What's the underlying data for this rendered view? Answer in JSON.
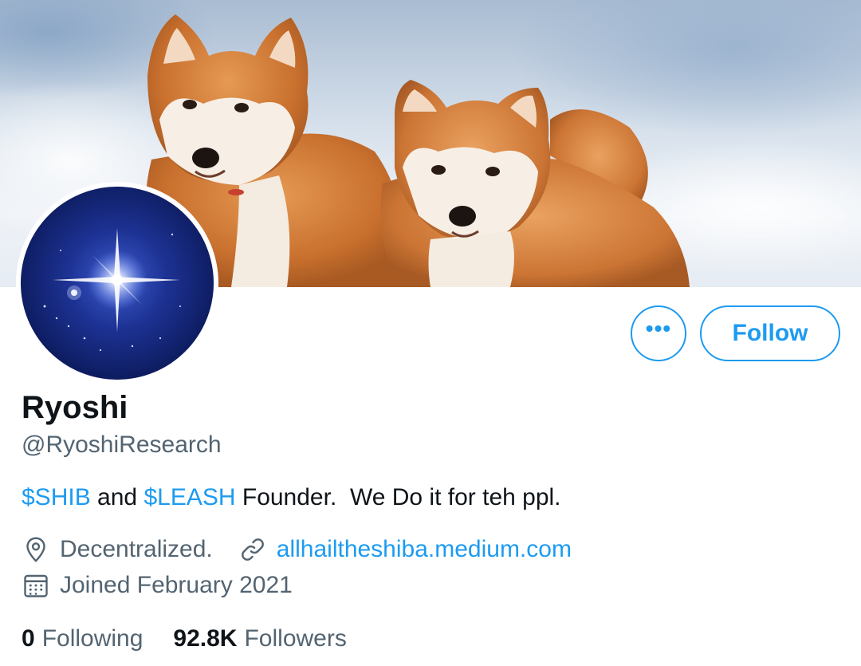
{
  "profile": {
    "display_name": "Ryoshi",
    "handle": "@RyoshiResearch",
    "bio": {
      "cashtag1": "$SHIB",
      "and": " and ",
      "cashtag2": "$LEASH",
      "rest": " Founder.  We Do it for teh ppl."
    },
    "location": "Decentralized.",
    "website": "allhailtheshiba.medium.com",
    "joined": "Joined February 2021"
  },
  "actions": {
    "more_label": "•••",
    "follow_label": "Follow"
  },
  "stats": {
    "following_count": "0",
    "following_label": "Following",
    "followers_count": "92.8K",
    "followers_label": "Followers"
  },
  "icons": {
    "more": "more-icon",
    "location": "location-pin-icon",
    "link": "link-icon",
    "calendar": "calendar-icon"
  },
  "colors": {
    "accent": "#1d9bf0",
    "text_primary": "#0f1419",
    "text_secondary": "#536471"
  }
}
